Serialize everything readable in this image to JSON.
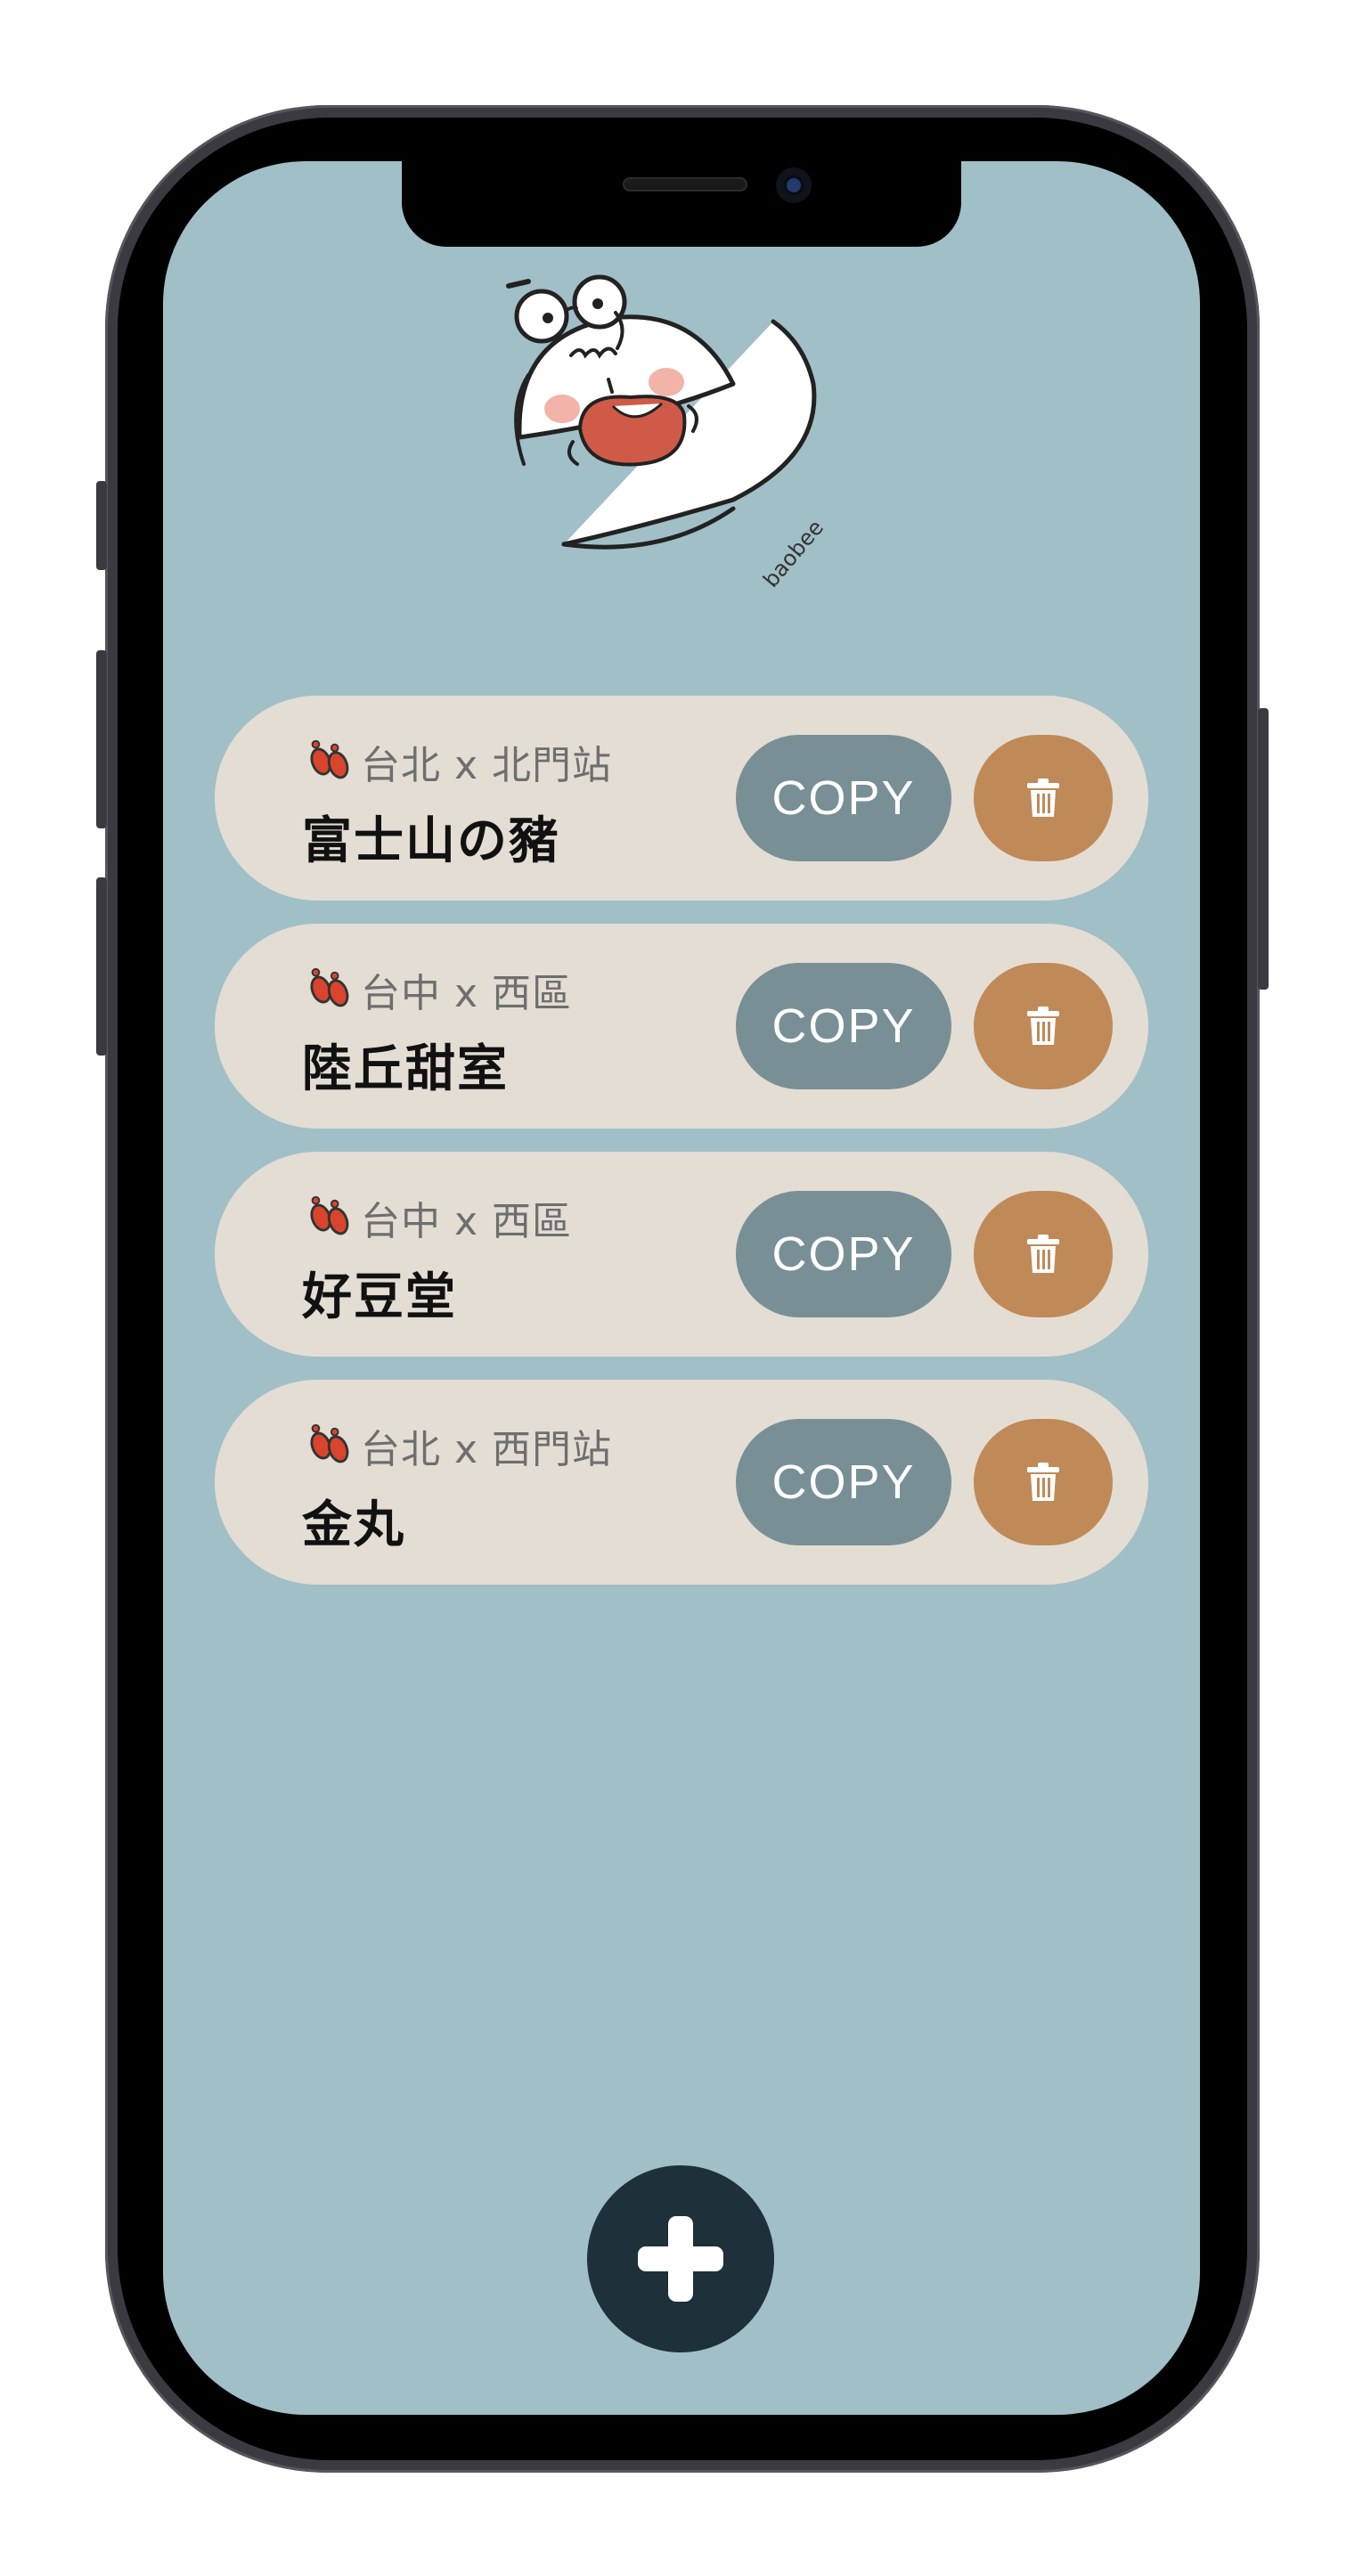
{
  "theme": {
    "background": "#a1bfc7",
    "card": "#e3ddd4",
    "copy_button": "#788f96",
    "delete_button": "#bf8a58",
    "add_button": "#1e3039",
    "feet_icon": "#d9452c"
  },
  "logo": {
    "text": "baobee"
  },
  "places": [
    {
      "location": "台北 x 北門站",
      "name": "富士山の豬",
      "copy_label": "COPY",
      "delete_icon": "trash-icon"
    },
    {
      "location": "台中 x 西區",
      "name": "陸丘甜室",
      "copy_label": "COPY",
      "delete_icon": "trash-icon"
    },
    {
      "location": "台中 x 西區",
      "name": "好豆堂",
      "copy_label": "COPY",
      "delete_icon": "trash-icon"
    },
    {
      "location": "台北 x 西門站",
      "name": "金丸",
      "copy_label": "COPY",
      "delete_icon": "trash-icon"
    }
  ],
  "add_button": {
    "icon": "plus-icon"
  }
}
